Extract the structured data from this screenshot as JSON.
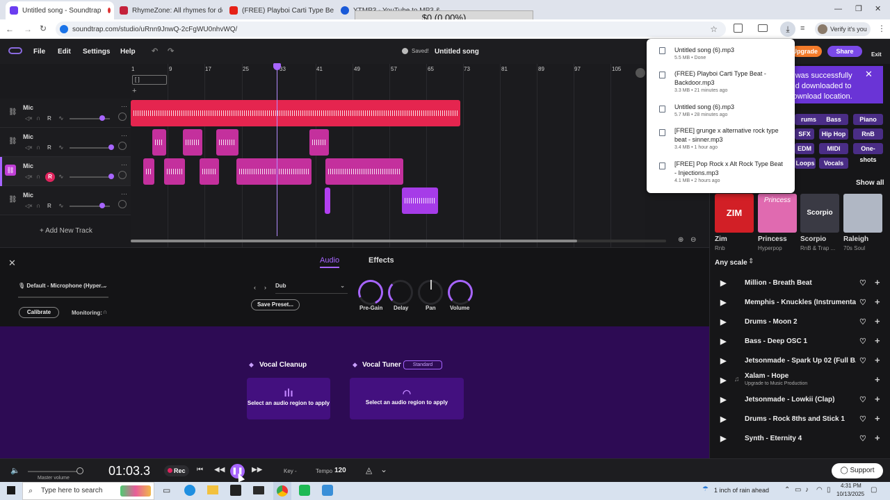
{
  "browser": {
    "tabs": [
      {
        "title": "Untitled song - Soundtrap",
        "active": true
      },
      {
        "title": "RhymeZone: All rhymes for dog",
        "active": false
      },
      {
        "title": "(FREE) Playboi Carti Type Beat -",
        "active": false
      },
      {
        "title": "YTMP3 - YouTube to MP3 & M",
        "active": false
      }
    ],
    "url": "soundtrap.com/studio/uRnn9JnwQ-2cFgWU0nhvWQ/",
    "verify_label": "Verify it's you",
    "overlay_value": "$0 (0.00%)"
  },
  "app": {
    "menu": [
      "File",
      "Edit",
      "Settings",
      "Help"
    ],
    "saved_label": "Saved!",
    "song_title": "Untitled song",
    "upgrade_label": "Upgrade",
    "share_label": "Share",
    "exit_label": "Exit"
  },
  "ruler": {
    "ticks": [
      "1",
      "9",
      "17",
      "25",
      "33",
      "41",
      "49",
      "57",
      "65",
      "73",
      "81",
      "89",
      "97",
      "105"
    ],
    "loop_label": "[  ]"
  },
  "tracks": [
    {
      "name": "Mic"
    },
    {
      "name": "Mic"
    },
    {
      "name": "Mic"
    },
    {
      "name": "Mic"
    }
  ],
  "add_track_label": "+ Add New Track",
  "fx": {
    "tabs": [
      "Audio",
      "Effects"
    ],
    "device_label": "Default - Microphone (Hyper...",
    "calibrate_label": "Calibrate",
    "monitoring_label": "Monitoring:",
    "preset_name": "Dub",
    "save_preset_label": "Save Preset...",
    "knobs": [
      "Pre-Gain",
      "Delay",
      "Pan",
      "Volume"
    ]
  },
  "vocal": {
    "cleanup_title": "Vocal Cleanup",
    "tuner_title": "Vocal Tuner",
    "tuner_mode": "Standard",
    "hint": "Select an audio region to apply"
  },
  "notification": {
    "text": "ect was successfully\nl and downloaded to\nlt download location."
  },
  "right_panel": {
    "tags": [
      "rums",
      "Bass",
      "Piano",
      "SFX",
      "Hip Hop",
      "RnB",
      "EDM",
      "MIDI",
      "One-shots",
      "Loops",
      "Vocals"
    ],
    "show_all": "Show all",
    "packs": [
      {
        "name": "Zim",
        "genre": "Rnb",
        "art": "ZIM",
        "color": "#d21f26"
      },
      {
        "name": "Princess",
        "genre": "Hyperpop",
        "art": "Princess",
        "color": "#e06ab0"
      },
      {
        "name": "Scorpio",
        "genre": "RnB & Trap ...",
        "art": "Scorpio",
        "color": "#3a3a44"
      },
      {
        "name": "Raleigh",
        "genre": "70s Soul",
        "art": "",
        "color": "#b0b7c4"
      }
    ],
    "scale_label": "Any scale",
    "loops": [
      {
        "name": "Million - Breath Beat",
        "sub": "",
        "locked": false
      },
      {
        "name": "Memphis - Knuckles (Instrumental)",
        "sub": "",
        "locked": false
      },
      {
        "name": "Drums - Moon 2",
        "sub": "",
        "locked": false
      },
      {
        "name": "Bass - Deep OSC 1",
        "sub": "",
        "locked": false
      },
      {
        "name": "Jetsonmade - Spark Up 02 (Full B...",
        "sub": "",
        "locked": false
      },
      {
        "name": "Xalam - Hope",
        "sub": "Upgrade to Music Production",
        "locked": true
      },
      {
        "name": "Jetsonmade - Lowkii (Clap)",
        "sub": "",
        "locked": false
      },
      {
        "name": "Drums - Rock 8ths and Stick 1",
        "sub": "",
        "locked": false
      },
      {
        "name": "Synth - Eternity 4",
        "sub": "",
        "locked": false
      }
    ]
  },
  "downloads": [
    {
      "name": "Untitled song (6).mp3",
      "meta": "5.5 MB • Done"
    },
    {
      "name": "(FREE) Playboi Carti Type Beat - Backdoor.mp3",
      "meta": "3.3 MB • 21 minutes ago"
    },
    {
      "name": "Untitled song (6).mp3",
      "meta": "5.7 MB • 28 minutes ago"
    },
    {
      "name": "[FREE] grunge x alternative rock type beat - sinner.mp3",
      "meta": "3.4 MB • 1 hour ago"
    },
    {
      "name": "[FREE] Pop Rock x Alt Rock Type Beat - Injections.mp3",
      "meta": "4.1 MB • 2 hours ago"
    }
  ],
  "transport": {
    "master_label": "Master volume",
    "time": "01:03.3",
    "rec_label": "Rec",
    "key_label": "Key -",
    "tempo_label": "Tempo",
    "tempo_value": "120",
    "support_label": "Support"
  },
  "taskbar": {
    "search_placeholder": "Type here to search",
    "weather": "1 inch of rain ahead",
    "time": "4:31 PM",
    "date": "10/13/2025"
  },
  "colors": {
    "accent": "#a765ff",
    "clip_red": "#e5254f",
    "clip_pink": "#c4309d",
    "purple_panel": "#2d0b54"
  }
}
